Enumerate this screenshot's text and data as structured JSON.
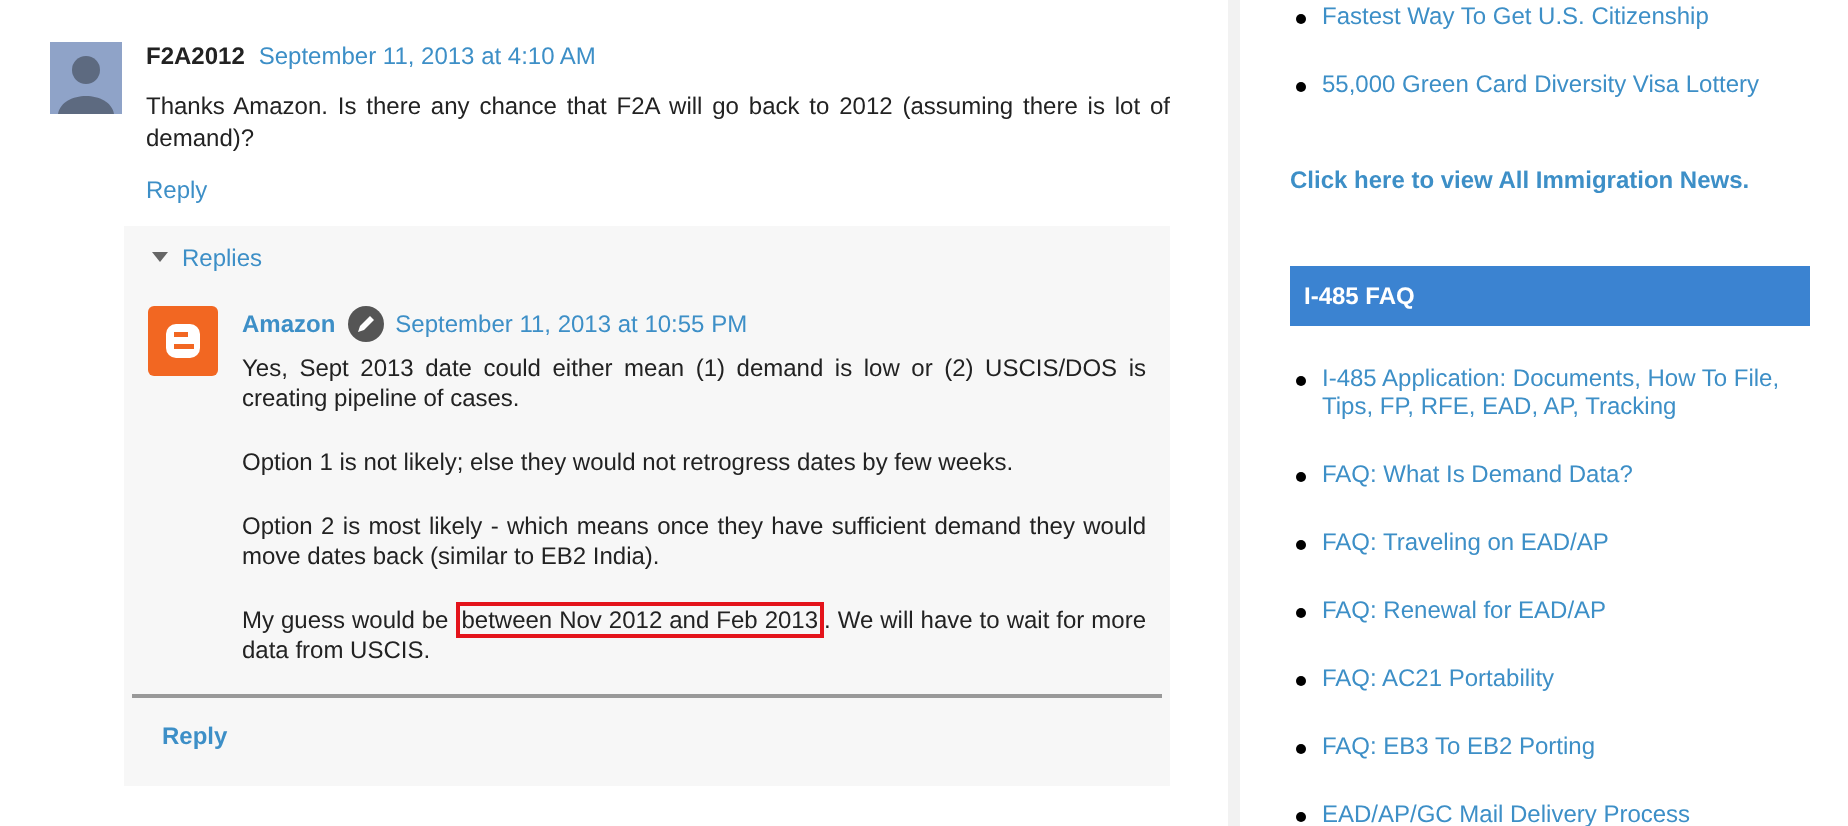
{
  "comment": {
    "author": "F2A2012",
    "timestamp": "September 11, 2013 at 4:10 AM",
    "body": "Thanks Amazon. Is there any chance that F2A will go back to 2012 (assuming there is lot of demand)?",
    "reply_link": "Reply"
  },
  "replies": {
    "toggle": "Replies",
    "expanded": true,
    "items": [
      {
        "author": "Amazon",
        "timestamp": "September 11, 2013 at 10:55 PM",
        "paragraphs": [
          {
            "before": "Yes, Sept 2013 date could either mean (1) demand is low or (2) USCIS/DOS is creating pipeline of cases."
          },
          {
            "before": "Option 1 is not likely; else they would not retrogress dates by few weeks."
          },
          {
            "before": "Option 2 is most likely - which means once they have sufficient demand they would move dates back (similar to EB2 India)."
          },
          {
            "before": "My guess would be ",
            "highlight": "between Nov 2012 and Feb 2013",
            "after": ". We will have to wait for more data from USCIS."
          }
        ]
      }
    ],
    "reply_button": "Reply"
  },
  "sidebar": {
    "news_links": [
      "Fastest Way To Get U.S. Citizenship",
      "55,000 Green Card Diversity Visa Lottery"
    ],
    "all_news_link": "Click here to view All Immigration News.",
    "faq_heading": "I-485 FAQ",
    "faq_links": [
      "I-485 Application: Documents, How To File, Tips, FP, RFE, EAD, AP, Tracking",
      "FAQ: What Is Demand Data?",
      "FAQ: Traveling on EAD/AP",
      "FAQ: Renewal for EAD/AP",
      "FAQ: AC21 Portability",
      "FAQ: EB3 To EB2 Porting",
      "EAD/AP/GC Mail Delivery Process"
    ]
  }
}
